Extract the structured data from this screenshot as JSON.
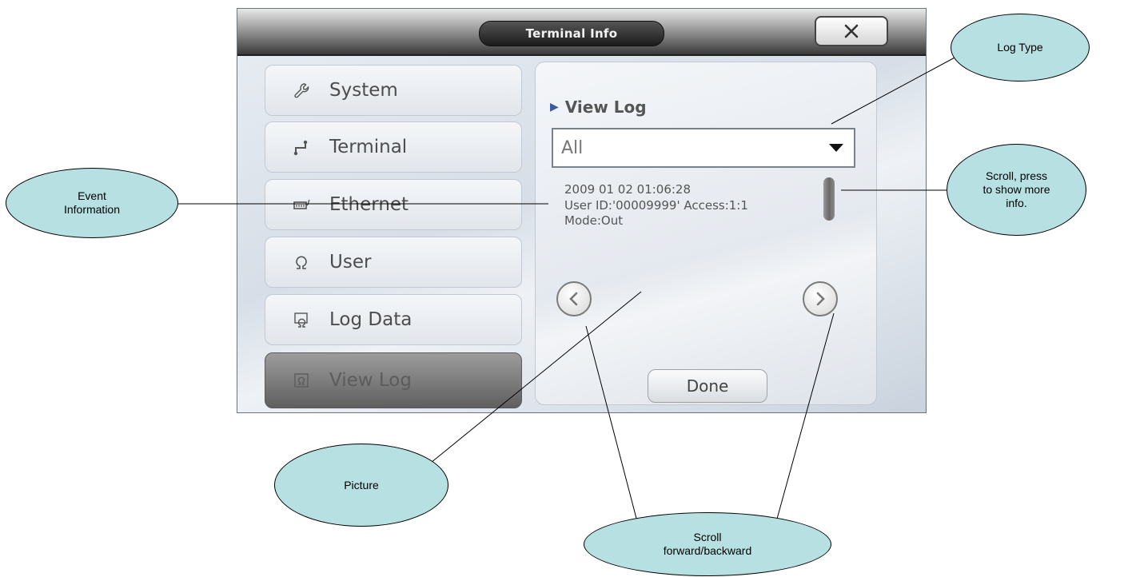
{
  "window": {
    "title": "Terminal Info",
    "close_icon": "close-icon"
  },
  "sidebar": {
    "items": [
      {
        "label": "System",
        "icon": "wrench-icon"
      },
      {
        "label": "Terminal",
        "icon": "terminal-icon"
      },
      {
        "label": "Ethernet",
        "icon": "ethernet-icon"
      },
      {
        "label": "User",
        "icon": "user-icon"
      },
      {
        "label": "Log Data",
        "icon": "log-data-icon"
      },
      {
        "label": "View Log",
        "icon": "view-log-icon",
        "active": true
      }
    ]
  },
  "panel": {
    "title": "View Log",
    "log_type": {
      "selected": "All"
    },
    "event": {
      "line1": "2009 01 02 01:06:28",
      "line2": "User ID:'00009999' Access:1:1",
      "line3": "Mode:Out"
    },
    "done_label": "Done"
  },
  "callouts": {
    "log_type": "Log Type",
    "event_info_1": "Event",
    "event_info_2": "Information",
    "scroll_more_1": "Scroll, press",
    "scroll_more_2": "to show more",
    "scroll_more_3": "info.",
    "picture": "Picture",
    "scroll_nav_1": "Scroll",
    "scroll_nav_2": "forward/backward"
  },
  "colors": {
    "callout_fill": "#b7e0e2",
    "accent": "#3b5aa6"
  }
}
